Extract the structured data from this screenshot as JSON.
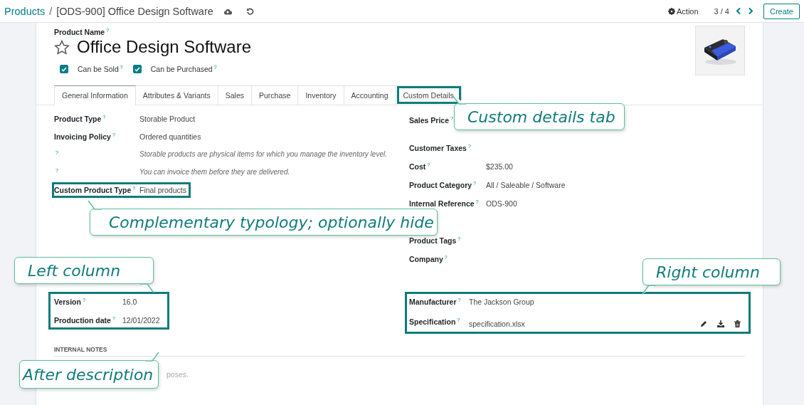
{
  "breadcrumb": {
    "parent": "Products",
    "separator": "/",
    "current": "[ODS-900] Office Design Software"
  },
  "control_panel": {
    "action": "Action",
    "pager": "3 / 4",
    "create": "Create"
  },
  "product": {
    "name_label": "Product Name",
    "name_help": "?",
    "name": "Office Design Software",
    "favorite": false
  },
  "options": [
    {
      "label": "Can be Sold",
      "help": "?",
      "checked": true
    },
    {
      "label": "Can be Purchased",
      "help": "?",
      "checked": true
    }
  ],
  "tabs": [
    {
      "label": "General Information",
      "selected": true,
      "highlighted": false
    },
    {
      "label": "Attributes & Variants",
      "selected": false,
      "highlighted": false
    },
    {
      "label": "Sales",
      "selected": false,
      "highlighted": false
    },
    {
      "label": "Purchase",
      "selected": false,
      "highlighted": false
    },
    {
      "label": "Inventory",
      "selected": false,
      "highlighted": false
    },
    {
      "label": "Accounting",
      "selected": false,
      "highlighted": false
    },
    {
      "label": "Custom Details",
      "selected": false,
      "highlighted": true
    }
  ],
  "left_fields": [
    {
      "kind": "field",
      "label": "Product Type",
      "help": "?",
      "value": "Storable Product",
      "highlighted": false
    },
    {
      "kind": "field",
      "label": "Invoicing Policy",
      "help": "?",
      "value": "Ordered quantities",
      "highlighted": false
    },
    {
      "kind": "hint",
      "help": "?",
      "value": "Storable products are physical items for which you manage the inventory level."
    },
    {
      "kind": "hint",
      "help": "?",
      "value": "You can invoice them before they are delivered."
    },
    {
      "kind": "field",
      "label": "Custom Product Type",
      "help": "?",
      "value": "Final products",
      "highlighted": true
    }
  ],
  "right_fields": [
    {
      "kind": "field",
      "label": "Sales Price",
      "help": "?"
    },
    {
      "kind": "field",
      "label": "Customer Taxes",
      "help": "?"
    },
    {
      "kind": "field",
      "label": "Cost",
      "help": "?",
      "value": "$235.00"
    },
    {
      "kind": "field",
      "label": "Product Category",
      "help": "?",
      "value": "All / Saleable / Software"
    },
    {
      "kind": "field",
      "label": "Internal Reference",
      "help": "?",
      "value": "ODS-900"
    },
    {
      "kind": "gap"
    },
    {
      "kind": "field",
      "label": "Product Tags",
      "help": "?"
    },
    {
      "kind": "field",
      "label": "Company",
      "help": "?"
    }
  ],
  "custom_left": {
    "highlighted": true,
    "fields": [
      {
        "kind": "field",
        "label": "Version",
        "help": "?",
        "value": "16.0"
      },
      {
        "kind": "field",
        "label": "Production date",
        "help": "?",
        "value": "12/01/2022"
      }
    ]
  },
  "custom_right": {
    "highlighted": true,
    "fields": [
      {
        "kind": "field",
        "label": "Manufacturer",
        "help": "?",
        "value": "The Jackson Group"
      },
      {
        "kind": "file",
        "label": "Specification",
        "help": "?",
        "value": "specification.xlsx"
      }
    ]
  },
  "notes": {
    "heading": "INTERNAL NOTES",
    "placeholder": "poses."
  },
  "annotations": [
    {
      "text": "Custom details tab"
    },
    {
      "text": "Complementary typology; optionally hide"
    },
    {
      "text": "Left column"
    },
    {
      "text": "Right column"
    },
    {
      "text": "After description"
    }
  ]
}
